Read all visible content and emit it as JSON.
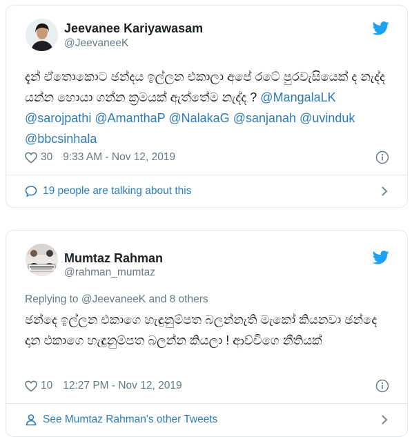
{
  "tweet1": {
    "author_name": "Jeevanee Kariyawasam",
    "author_handle": "@JeevaneeK",
    "text_plain": "දැන් ඒතොකොට ඡන්දය ඉල්ලන එකාලා අපේ රටේ පුරවැසියෙක් ද නැද්ද යන්න හොයා ගන්න ක්‍රමයක් ඇත්තේම නැද්ද ? ",
    "mentions": [
      "@MangalaLK",
      "@sarojpathi",
      "@AmanthaP",
      "@NalakaG",
      "@sanjanah",
      "@uvinduk",
      "@bbcsinhala"
    ],
    "likes": "30",
    "timestamp": "9:33 AM - Nov 12, 2019",
    "footer_label": "19 people are talking about this"
  },
  "tweet2": {
    "author_name": "Mumtaz Rahman",
    "author_handle": "@rahman_mumtaz",
    "replying_to": "Replying to @JeevaneeK and 8 others",
    "text": "ඡන්දෙ ඉල්ලන එකාගෙ හැඳුනුම්පත බලන්නැති මැකෝ කියනවා ඡන්දෙ දාන එකාගෙ හැඳුනුම්පත බලන්න කියලා ! ආච්චිගෙ නීතියක්",
    "likes": "10",
    "timestamp": "12:27 PM - Nov 12, 2019",
    "footer_label": "See Mumtaz Rahman's other Tweets"
  },
  "colors": {
    "link_blue": "#2b7bb9",
    "twitter_blue": "#1da1f2",
    "secondary_text": "#697882",
    "border": "#e1e8ed"
  },
  "icons": [
    "twitter-bird-icon",
    "heart-icon",
    "info-icon",
    "speech-bubble-icon",
    "person-icon",
    "chevron-right-icon"
  ]
}
